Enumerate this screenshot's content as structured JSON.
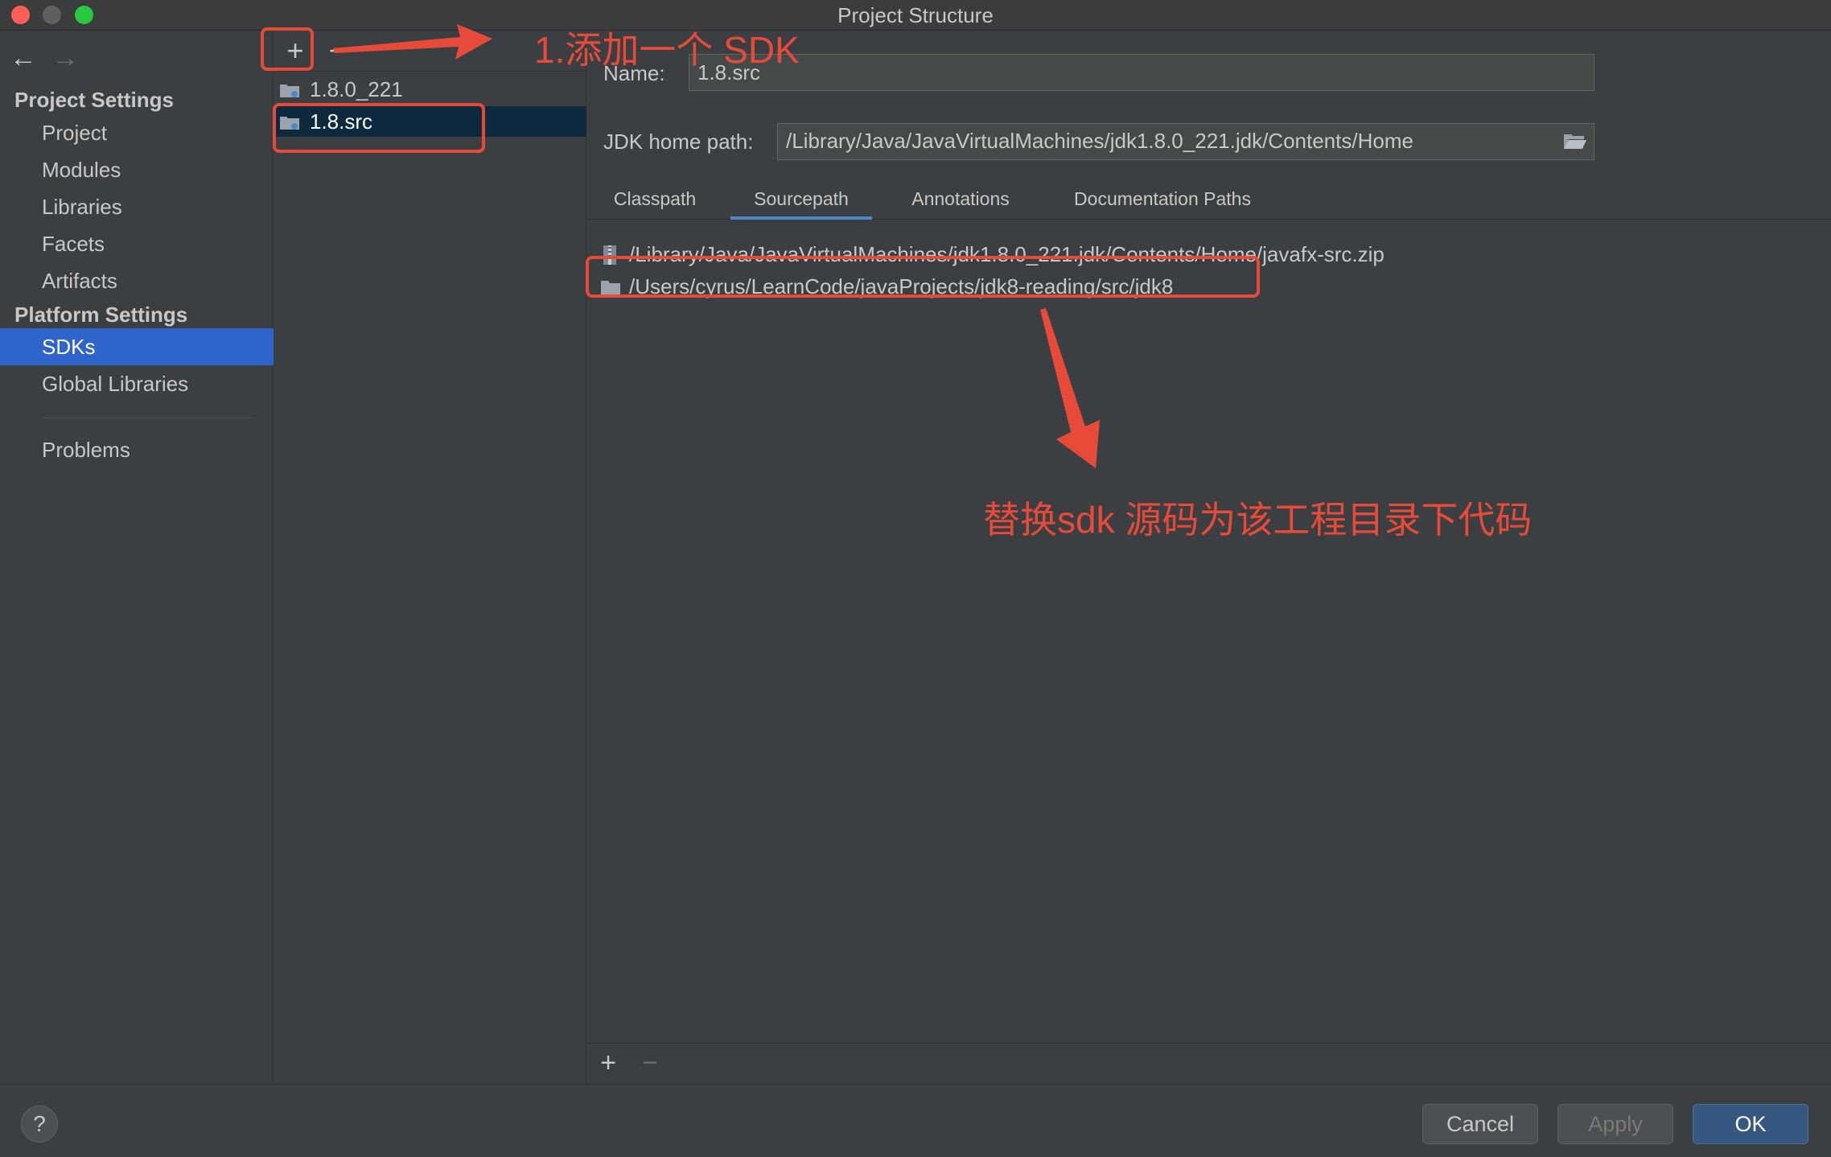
{
  "window": {
    "title": "Project Structure"
  },
  "nav": {
    "back": "←",
    "forward": "→"
  },
  "sidebar": {
    "project_settings_header": "Project Settings",
    "project_items": [
      "Project",
      "Modules",
      "Libraries",
      "Facets",
      "Artifacts"
    ],
    "platform_settings_header": "Platform Settings",
    "platform_items": [
      "SDKs",
      "Global Libraries"
    ],
    "selected": "SDKs",
    "problems": "Problems"
  },
  "sdk_list": {
    "add_label": "+",
    "remove_label": "−",
    "items": [
      "1.8.0_221",
      "1.8.src"
    ],
    "selected": "1.8.src"
  },
  "detail": {
    "name_label": "Name:",
    "name_value": "1.8.src",
    "home_label": "JDK home path:",
    "home_value": "/Library/Java/JavaVirtualMachines/jdk1.8.0_221.jdk/Contents/Home",
    "tabs": [
      "Classpath",
      "Sourcepath",
      "Annotations",
      "Documentation Paths"
    ],
    "active_tab": "Sourcepath",
    "paths": [
      "/Library/Java/JavaVirtualMachines/jdk1.8.0_221.jdk/Contents/Home/javafx-src.zip",
      "/Users/cyrus/LearnCode/javaProjects/jdk8-reading/src/jdk8"
    ],
    "add_label": "+",
    "remove_label": "−"
  },
  "footer": {
    "help_label": "?",
    "cancel_label": "Cancel",
    "apply_label": "Apply",
    "ok_label": "OK"
  },
  "annotations": {
    "step1": "1.添加一个 SDK",
    "step2": "替换sdk 源码为该工程目录下代码",
    "color": "#e84a3a"
  },
  "colors": {
    "accent": "#2f65ca",
    "tab_underline": "#4a88c7",
    "ok_button": "#365880",
    "panel_bg": "#3c3f41"
  }
}
